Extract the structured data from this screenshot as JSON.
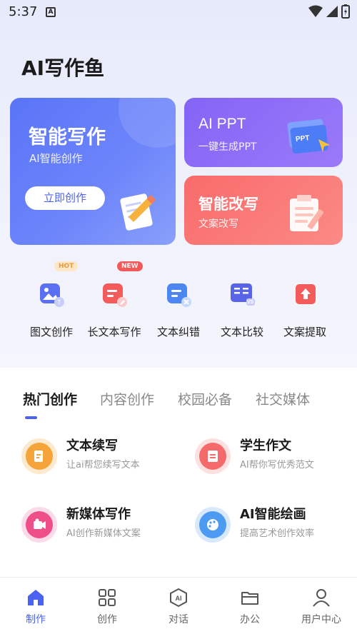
{
  "status": {
    "time": "5:37"
  },
  "app": {
    "title": "AI写作鱼"
  },
  "cards": {
    "write": {
      "title": "智能写作",
      "subtitle": "AI智能创作",
      "button": "立即创作"
    },
    "ppt": {
      "title": "AI PPT",
      "subtitle": "一键生成PPT",
      "graphic_label": "PPT"
    },
    "rewrite": {
      "title": "智能改写",
      "subtitle": "文案改写"
    }
  },
  "tools": [
    {
      "label": "图文创作",
      "badge": "HOT",
      "icon": "image-text-icon",
      "color": "#5b6ff2"
    },
    {
      "label": "长文本写作",
      "badge": "NEW",
      "icon": "long-text-icon",
      "color": "#f45b5b"
    },
    {
      "label": "文本纠错",
      "badge": "",
      "icon": "text-correct-icon",
      "color": "#4c86f0"
    },
    {
      "label": "文本比较",
      "badge": "",
      "icon": "text-compare-icon",
      "color": "#5a64e8",
      "icon_text": "VS"
    },
    {
      "label": "文案提取",
      "badge": "",
      "icon": "text-extract-icon",
      "color": "#f45b5b"
    }
  ],
  "tabs": [
    "热门创作",
    "内容创作",
    "校园必备",
    "社交媒体"
  ],
  "items": [
    {
      "title": "文本续写",
      "subtitle": "让ai帮您续写文本",
      "icon": "continue-write-icon",
      "color": "#f5a43a",
      "ring": "#fde9cd"
    },
    {
      "title": "学生作文",
      "subtitle": "AI帮你写优秀范文",
      "icon": "essay-icon",
      "color": "#f56b6b",
      "ring": "#fde0e0"
    },
    {
      "title": "新媒体写作",
      "subtitle": "AI创作新媒体文案",
      "icon": "new-media-icon",
      "color": "#ef4f87",
      "ring": "#fbdbe8"
    },
    {
      "title": "AI智能绘画",
      "subtitle": "提高艺术创作效率",
      "icon": "ai-painting-icon",
      "color": "#4d9af2",
      "ring": "#d9e9fc"
    }
  ],
  "bottom_nav": [
    {
      "label": "制作",
      "icon": "home-icon",
      "active": true
    },
    {
      "label": "创作",
      "icon": "grid-icon",
      "active": false
    },
    {
      "label": "对话",
      "icon": "ai-chat-icon",
      "active": false
    },
    {
      "label": "办公",
      "icon": "folder-icon",
      "active": false
    },
    {
      "label": "用户中心",
      "icon": "user-icon",
      "active": false
    }
  ],
  "colors": {
    "accent": "#4c63f2",
    "card_write": "#5a74f8",
    "card_ppt": "#8464f6",
    "card_rewrite": "#f96b6b"
  }
}
